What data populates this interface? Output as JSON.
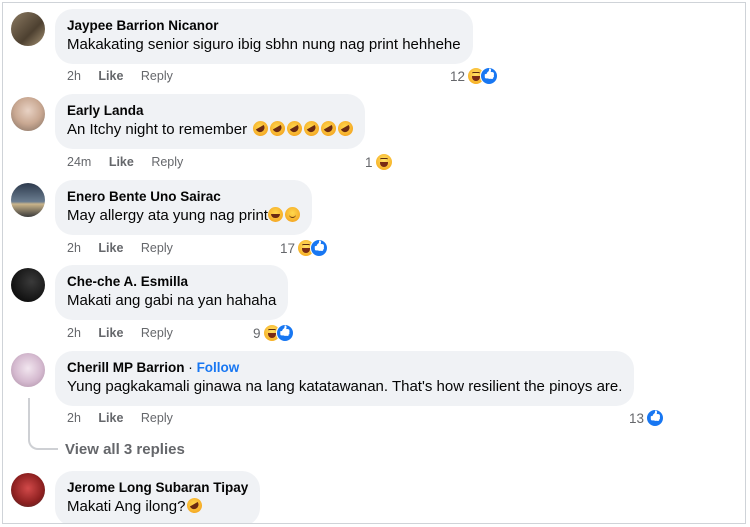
{
  "comments": [
    {
      "author": "Jaypee Barrion Nicanor",
      "text": "Makakating senior siguro ibig sbhn nung nag print hehhehe",
      "time": "2h",
      "like": "Like",
      "reply": "Reply",
      "reaction_count": "12",
      "reactions": [
        "haha-icon",
        "like-icon"
      ],
      "avatar_color": "#6b5a44"
    },
    {
      "author": "Early Landa",
      "text": "An Itchy night to remember",
      "time": "24m",
      "like": "Like",
      "reply": "Reply",
      "reaction_count": "1",
      "reactions": [
        "haha-icon"
      ],
      "inline_emojis": [
        "rofl-emoji",
        "rofl-emoji",
        "rofl-emoji",
        "rofl-emoji",
        "rofl-emoji",
        "rofl-emoji"
      ],
      "avatar_color": "#d9c6b9"
    },
    {
      "author": "Enero Bente Uno Sairac",
      "text": "May allergy ata yung nag print",
      "time": "2h",
      "like": "Like",
      "reply": "Reply",
      "reaction_count": "17",
      "reactions": [
        "haha-icon",
        "like-icon"
      ],
      "inline_emojis": [
        "teary-emoji",
        "smile-emoji"
      ],
      "avatar_color": "#4a5a6e"
    },
    {
      "author": "Che-che A. Esmilla",
      "text": "Makati ang gabi na yan hahaha",
      "time": "2h",
      "like": "Like",
      "reply": "Reply",
      "reaction_count": "9",
      "reactions": [
        "haha-icon",
        "like-icon"
      ],
      "avatar_color": "#1a1a1a"
    },
    {
      "author": "Cherill MP Barrion",
      "follow_sep": "·",
      "follow": "Follow",
      "text": "Yung pagkakamali ginawa na lang katatawanan. That's how resilient the pinoys are.",
      "time": "2h",
      "like": "Like",
      "reply": "Reply",
      "reaction_count": "13",
      "reactions": [
        "like-icon"
      ],
      "avatar_color": "#c9b5c8"
    },
    {
      "author": "Jerome Long Subaran Tipay",
      "text": "Makati Ang ilong?",
      "inline_emojis": [
        "rofl-emoji"
      ],
      "avatar_color": "#b03030"
    }
  ],
  "view_replies": "View all 3 replies"
}
